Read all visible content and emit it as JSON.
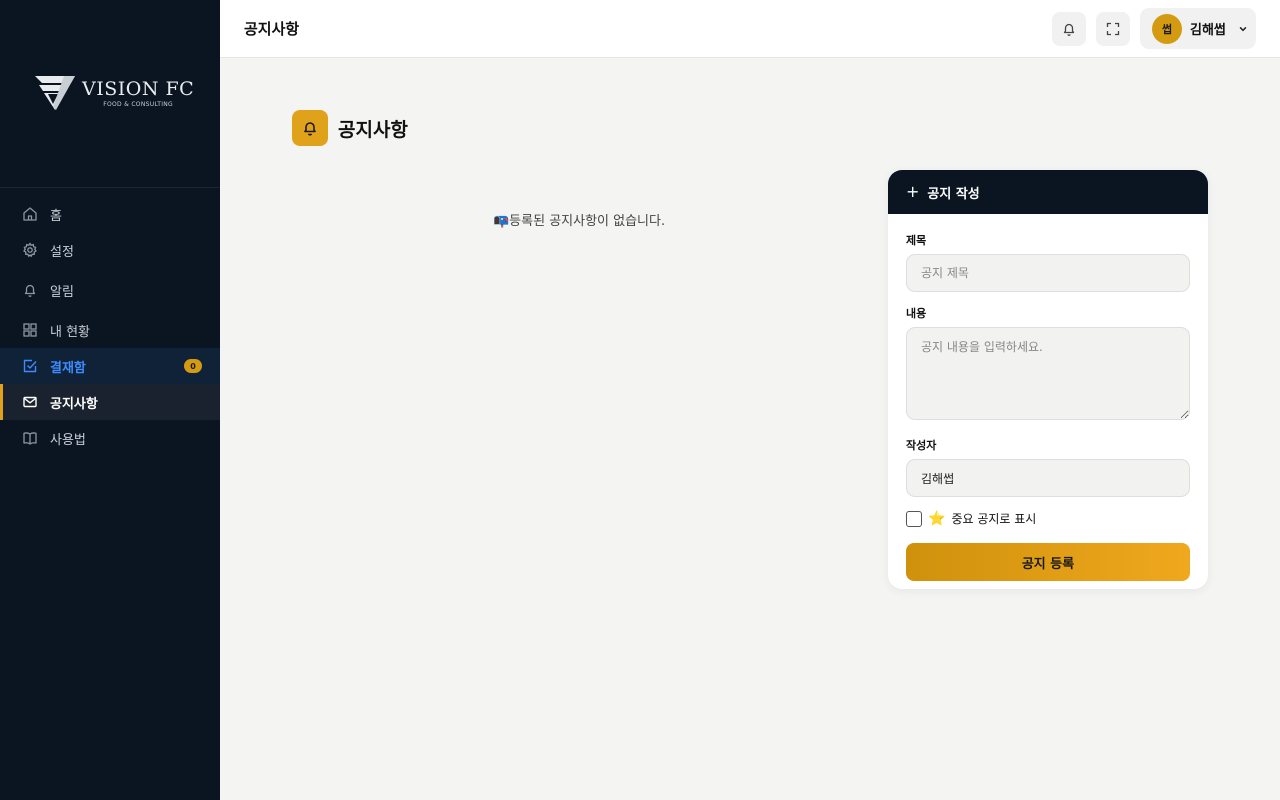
{
  "brand": {
    "name": "VISION FC",
    "tagline": "FOOD & CONSULTING"
  },
  "sidebar": {
    "items": [
      {
        "label": "홈",
        "icon": "home-icon"
      },
      {
        "label": "설정",
        "icon": "gear-icon"
      },
      {
        "label": "알림",
        "icon": "bell-icon"
      },
      {
        "label": "내 현황",
        "icon": "grid-icon"
      },
      {
        "label": "결재함",
        "icon": "checkbox-icon",
        "badge": "0"
      },
      {
        "label": "공지사항",
        "icon": "mail-icon",
        "active": true
      },
      {
        "label": "사용법",
        "icon": "book-icon"
      }
    ]
  },
  "header": {
    "title": "공지사항",
    "user": {
      "avatar_text": "썹",
      "name": "김해썹"
    }
  },
  "page": {
    "title": "공지사항",
    "empty_message": "📭등록된 공지사항이 없습니다."
  },
  "form": {
    "title": "공지 작성",
    "title_field": {
      "label": "제목",
      "placeholder": "공지 제목",
      "value": ""
    },
    "content_field": {
      "label": "내용",
      "placeholder": "공지 내용을 입력하세요.",
      "value": ""
    },
    "author_field": {
      "label": "작성자",
      "value": "김해썹"
    },
    "important_label": "중요 공지로 표시",
    "important_checked": false,
    "submit_label": "공지 등록"
  },
  "colors": {
    "sidebar_bg": "#0b1421",
    "accent": "#e0a21a",
    "approval_text": "#3d8bfd",
    "page_bg": "#f4f4f2"
  }
}
